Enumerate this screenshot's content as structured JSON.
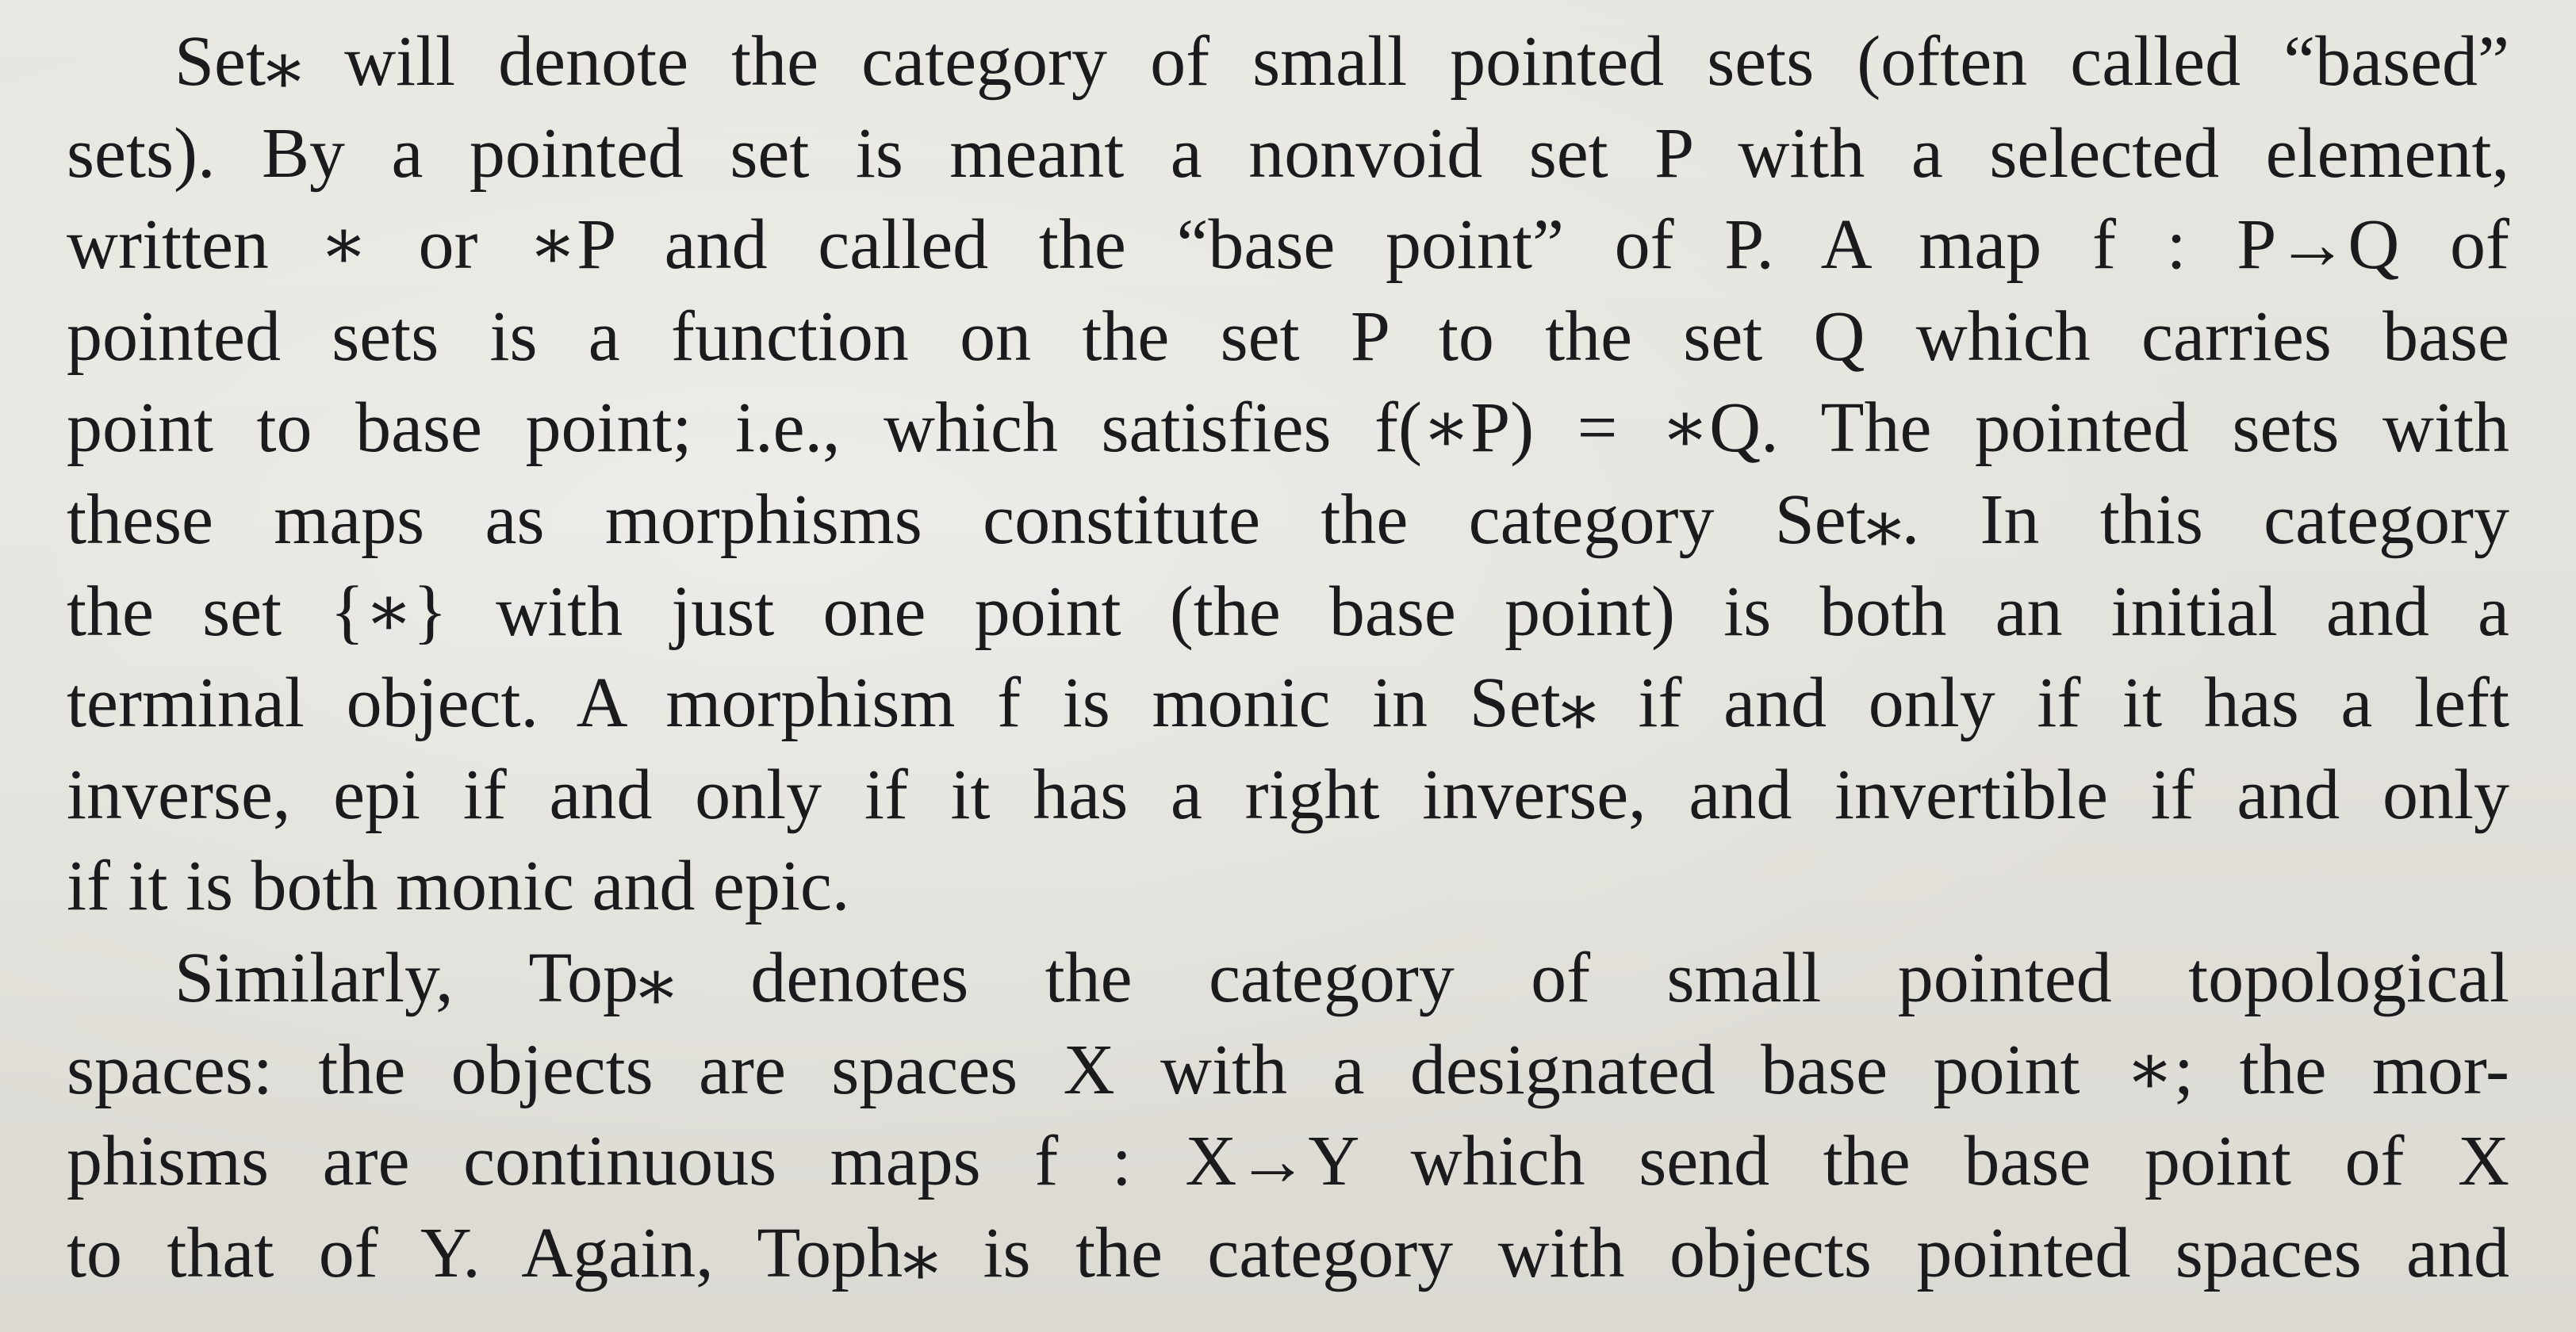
{
  "paragraphs": [
    {
      "lines": [
        "Set⁎ will denote the category of small pointed sets (often called “based”",
        "sets). By a pointed set is meant a nonvoid set P with a selected element,",
        "written ∗ or ∗P and called the “base point” of P. A map f : P→Q of",
        "pointed sets is a function on the set P to the set Q which carries base",
        "point to base point; i.e., which satisfies f(∗P) = ∗Q. The pointed sets with",
        "these maps as morphisms constitute the category Set⁎. In this category",
        "the set {∗} with just one point (the base point) is both an initial and a",
        "terminal object. A morphism f is monic in Set⁎ if and only if it has a left",
        "inverse, epi if and only if it has a right inverse, and invertible if and only",
        "if it is both monic and epic."
      ]
    },
    {
      "lines": [
        "Similarly, Top⁎ denotes the category of small pointed topological",
        "spaces: the objects are spaces X with a designated base point ∗; the mor-",
        "phisms are continuous maps f : X→Y which send the base point of X",
        "to that of Y. Again, Toph⁎ is the category with objects pointed spaces and"
      ]
    }
  ]
}
